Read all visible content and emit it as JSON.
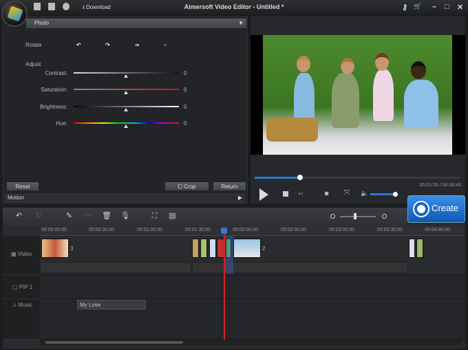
{
  "titlebar": {
    "title": "Aimersoft Video Editor - Untitled *",
    "download_label": "Download"
  },
  "photo_panel": {
    "header": "Photo",
    "rotate_label": "Rotate",
    "adjust_label": "Adjust",
    "adjustments": [
      {
        "label": "Contrast:",
        "value": "0"
      },
      {
        "label": "Saturation:",
        "value": "0"
      },
      {
        "label": "Brightness:",
        "value": "0"
      },
      {
        "label": "Hue:",
        "value": "0"
      }
    ],
    "reset_label": "Reset",
    "crop_label": "Crop",
    "return_label": "Return",
    "motion_label": "Motion"
  },
  "player": {
    "progress_fraction": 0.22,
    "time": "00:01:55 / 00:08:43",
    "volume_fraction": 0.8
  },
  "create_label": "Create",
  "timeline": {
    "ticks": [
      "00:00:00:00",
      "00:00:30:00",
      "00:01:00:00",
      "00:01:30:00",
      "00:02:00:00",
      "00:02:30:00",
      "00:03:00:00",
      "00:03:30:00",
      "00:04:00:00"
    ],
    "tracks": {
      "video": "Video",
      "pip": "PIP 1",
      "music": "Music"
    },
    "clip_numbers": [
      "3",
      "2"
    ],
    "music_clip": "My Love"
  }
}
